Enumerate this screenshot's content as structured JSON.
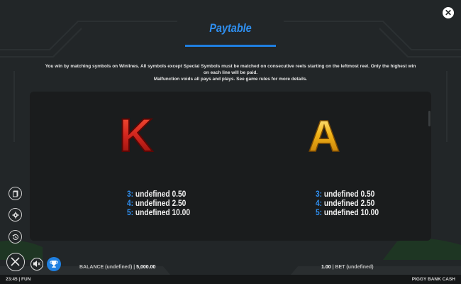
{
  "header": {
    "title": "Paytable",
    "close_icon": "close-icon",
    "accent_color": "#2f8ff0"
  },
  "intro": {
    "line1": "You win by matching symbols on Winlines. All symbols except Special Symbols must be matched on consecutive reels starting on the leftmost reel. Only the highest win on each line will be paid.",
    "line2": "Malfunction voids all pays and plays. See game rules for more details."
  },
  "symbols": [
    {
      "glyph": "K",
      "color": "#d2261e",
      "pays": [
        {
          "count": "3:",
          "amount": "undefined 0.50"
        },
        {
          "count": "4:",
          "amount": "undefined 2.50"
        },
        {
          "count": "5:",
          "amount": "undefined 10.00"
        }
      ]
    },
    {
      "glyph": "A",
      "color": "#f2b418",
      "pays": [
        {
          "count": "3:",
          "amount": "undefined 0.50"
        },
        {
          "count": "4:",
          "amount": "undefined 2.50"
        },
        {
          "count": "5:",
          "amount": "undefined 10.00"
        }
      ]
    }
  ],
  "side_menu": [
    {
      "icon": "paytable-icon"
    },
    {
      "icon": "settings-gear-icon"
    },
    {
      "icon": "history-icon"
    }
  ],
  "bottom_bar": {
    "balance_label": "BALANCE (undefined) |",
    "balance_value": "5,000.00",
    "bet_value": "1.00",
    "bet_label": "| BET (undefined)"
  },
  "footer": {
    "time_mode": "23:45 | FUN",
    "game_name": "PIGGY BANK CASH"
  }
}
